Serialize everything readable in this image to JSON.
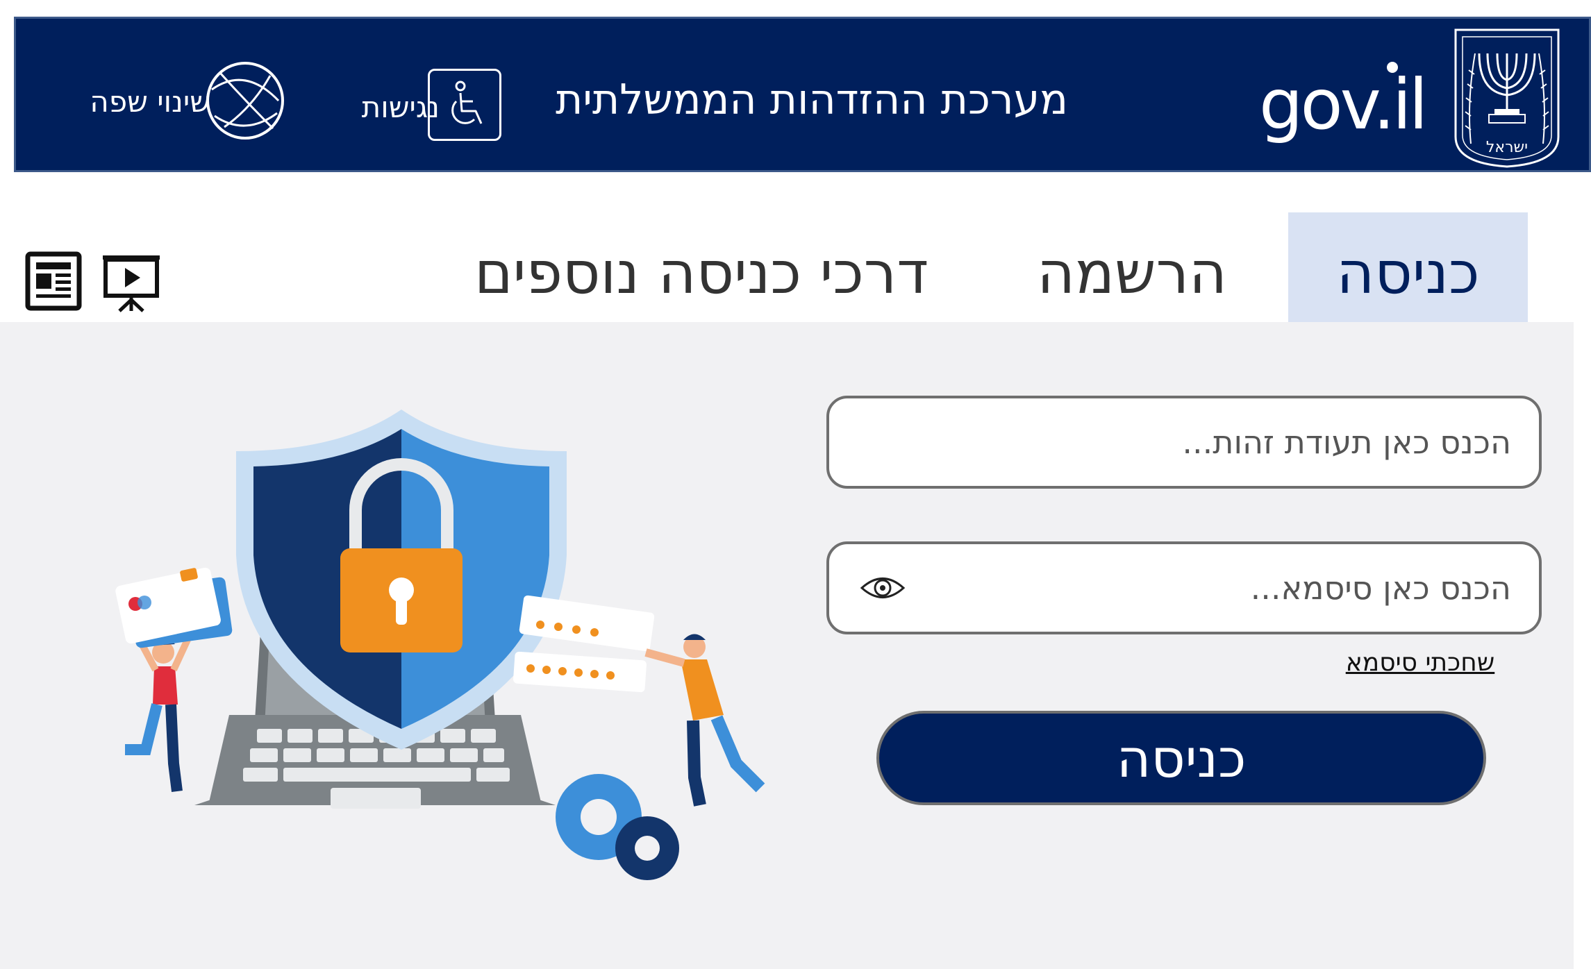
{
  "header": {
    "system_title": "מערכת ההזדהות הממשלתית",
    "logo_text": "gov.il",
    "emblem_text": "ישראל",
    "accessibility_label": "נגישות",
    "language_label": "שינוי שפה"
  },
  "tabs": [
    {
      "label": "כניסה",
      "active": true
    },
    {
      "label": "הרשמה",
      "active": false
    },
    {
      "label": "דרכי כניסה נוספים",
      "active": false
    }
  ],
  "login_form": {
    "id_placeholder": "הכנס כאן תעודת זהות...",
    "password_placeholder": "הכנס כאן סיסמא...",
    "forgot_password_link": "שחכתי סיסמא",
    "submit_label": "כניסה"
  },
  "icons": [
    "emblem-icon",
    "accessibility-icon",
    "globe-icon",
    "presentation-icon",
    "newspaper-icon",
    "eye-icon"
  ],
  "colors": {
    "header_bg": "#001f5c",
    "active_tab_bg": "#d9e2f3",
    "panel_bg": "#f1f1f3",
    "button_bg": "#001f5c"
  }
}
